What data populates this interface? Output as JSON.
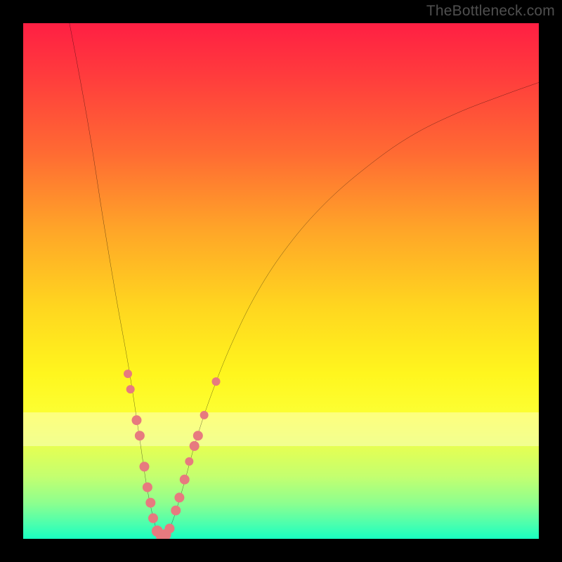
{
  "watermark": "TheBottleneck.com",
  "chart_data": {
    "type": "line",
    "title": "",
    "xlabel": "",
    "ylabel": "",
    "xlim": [
      0,
      100
    ],
    "ylim": [
      0,
      100
    ],
    "background": "rainbow-vertical-gradient",
    "curve": {
      "description": "V-shaped bottleneck curve, minimum near x≈26, rising asymptotically to both sides",
      "points": [
        {
          "x": 8.0,
          "y": 105.0
        },
        {
          "x": 10.5,
          "y": 92.0
        },
        {
          "x": 13.0,
          "y": 78.0
        },
        {
          "x": 15.5,
          "y": 62.0
        },
        {
          "x": 18.0,
          "y": 47.0
        },
        {
          "x": 20.5,
          "y": 33.0
        },
        {
          "x": 22.5,
          "y": 20.0
        },
        {
          "x": 24.0,
          "y": 10.0
        },
        {
          "x": 25.5,
          "y": 3.0
        },
        {
          "x": 26.5,
          "y": 0.5
        },
        {
          "x": 27.5,
          "y": 0.5
        },
        {
          "x": 29.0,
          "y": 3.5
        },
        {
          "x": 31.0,
          "y": 10.0
        },
        {
          "x": 33.5,
          "y": 19.0
        },
        {
          "x": 36.5,
          "y": 28.0
        },
        {
          "x": 40.5,
          "y": 38.0
        },
        {
          "x": 45.5,
          "y": 48.0
        },
        {
          "x": 51.5,
          "y": 57.0
        },
        {
          "x": 58.5,
          "y": 65.0
        },
        {
          "x": 66.5,
          "y": 72.0
        },
        {
          "x": 75.0,
          "y": 78.0
        },
        {
          "x": 84.0,
          "y": 82.5
        },
        {
          "x": 93.0,
          "y": 86.0
        },
        {
          "x": 100.0,
          "y": 88.5
        }
      ]
    },
    "dots": {
      "color": "#e77a7f",
      "radius_small": 6,
      "radius_large": 9,
      "points": [
        {
          "x": 20.3,
          "y": 32.0,
          "r": 6
        },
        {
          "x": 20.8,
          "y": 29.0,
          "r": 6
        },
        {
          "x": 22.0,
          "y": 23.0,
          "r": 7
        },
        {
          "x": 22.6,
          "y": 20.0,
          "r": 7
        },
        {
          "x": 23.5,
          "y": 14.0,
          "r": 7
        },
        {
          "x": 24.1,
          "y": 10.0,
          "r": 7
        },
        {
          "x": 24.7,
          "y": 7.0,
          "r": 7
        },
        {
          "x": 25.2,
          "y": 4.0,
          "r": 7
        },
        {
          "x": 26.0,
          "y": 1.5,
          "r": 8
        },
        {
          "x": 26.8,
          "y": 0.6,
          "r": 8
        },
        {
          "x": 27.6,
          "y": 0.8,
          "r": 8
        },
        {
          "x": 28.4,
          "y": 2.0,
          "r": 7
        },
        {
          "x": 29.6,
          "y": 5.5,
          "r": 7
        },
        {
          "x": 30.3,
          "y": 8.0,
          "r": 7
        },
        {
          "x": 31.3,
          "y": 11.5,
          "r": 7
        },
        {
          "x": 32.2,
          "y": 15.0,
          "r": 6
        },
        {
          "x": 33.2,
          "y": 18.0,
          "r": 7
        },
        {
          "x": 33.9,
          "y": 20.0,
          "r": 7
        },
        {
          "x": 35.1,
          "y": 24.0,
          "r": 6
        },
        {
          "x": 37.4,
          "y": 30.5,
          "r": 6
        }
      ]
    },
    "bright_band": {
      "top_pct": 75.5,
      "height_pct": 6.5
    }
  }
}
